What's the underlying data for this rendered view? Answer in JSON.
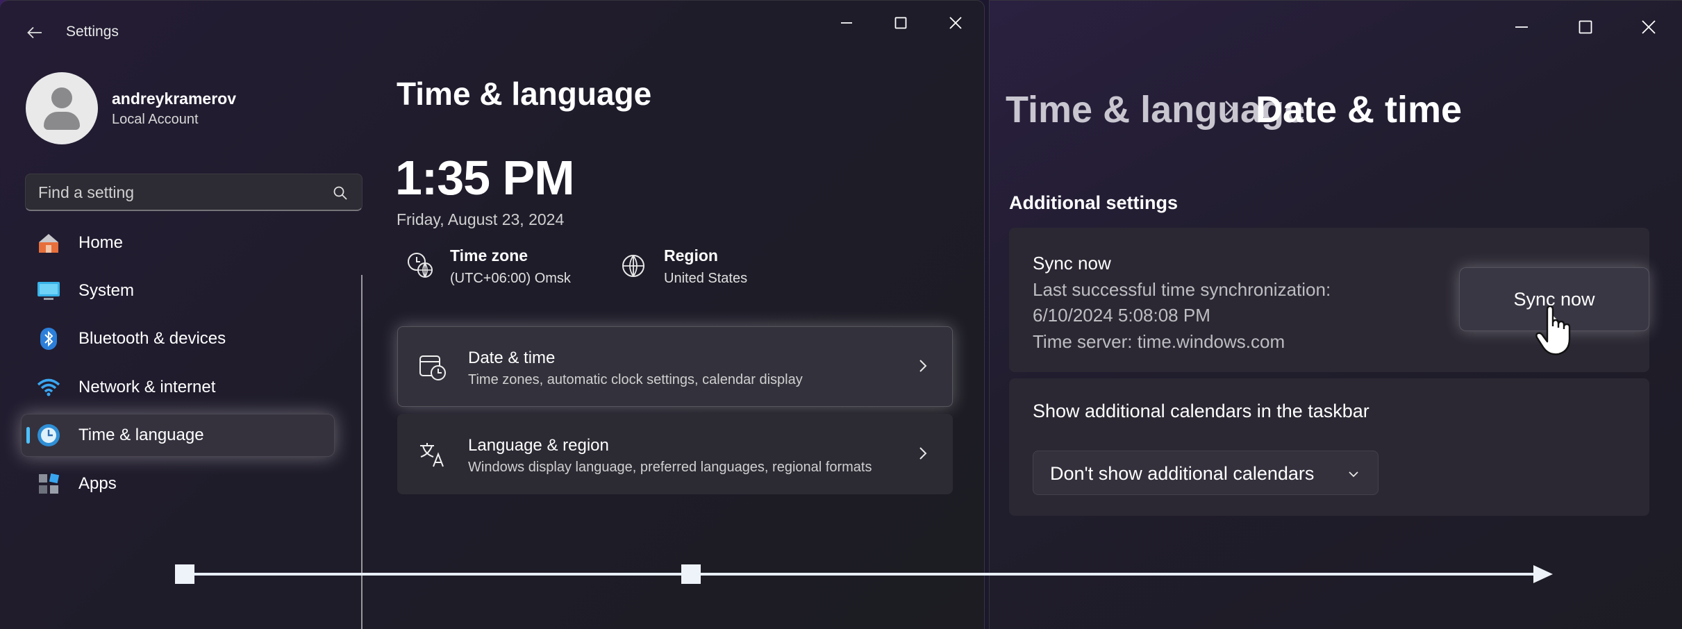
{
  "left_window": {
    "title": "Settings",
    "profile": {
      "name": "andreykramerov",
      "account_type": "Local Account"
    },
    "search": {
      "placeholder": "Find a setting"
    },
    "nav": [
      {
        "label": "Home",
        "icon": "home-icon"
      },
      {
        "label": "System",
        "icon": "monitor-icon"
      },
      {
        "label": "Bluetooth & devices",
        "icon": "bluetooth-icon"
      },
      {
        "label": "Network & internet",
        "icon": "wifi-icon"
      },
      {
        "label": "Time & language",
        "icon": "clock-globe-icon",
        "selected": true
      },
      {
        "label": "Apps",
        "icon": "apps-icon"
      }
    ],
    "page": {
      "title": "Time & language",
      "time": "1:35 PM",
      "date": "Friday, August 23, 2024",
      "timezone": {
        "label": "Time zone",
        "value": "(UTC+06:00) Omsk"
      },
      "region": {
        "label": "Region",
        "value": "United States"
      },
      "cards": [
        {
          "title": "Date & time",
          "description": "Time zones, automatic clock settings, calendar display"
        },
        {
          "title": "Language & region",
          "description": "Windows display language, preferred languages, regional formats"
        }
      ]
    }
  },
  "right_window": {
    "breadcrumb": {
      "parent": "Time & language",
      "current": "Date & time"
    },
    "section_title": "Additional settings",
    "sync": {
      "title": "Sync now",
      "last_sync_label": "Last successful time synchronization:",
      "last_sync_value": "6/10/2024 5:08:08 PM",
      "server": "Time server: time.windows.com",
      "button_label": "Sync now"
    },
    "calendars": {
      "title": "Show additional calendars in the taskbar",
      "selected": "Don't show additional calendars"
    }
  },
  "colors": {
    "accent": "#4cc2ff",
    "annotation": "#e8eef6"
  }
}
